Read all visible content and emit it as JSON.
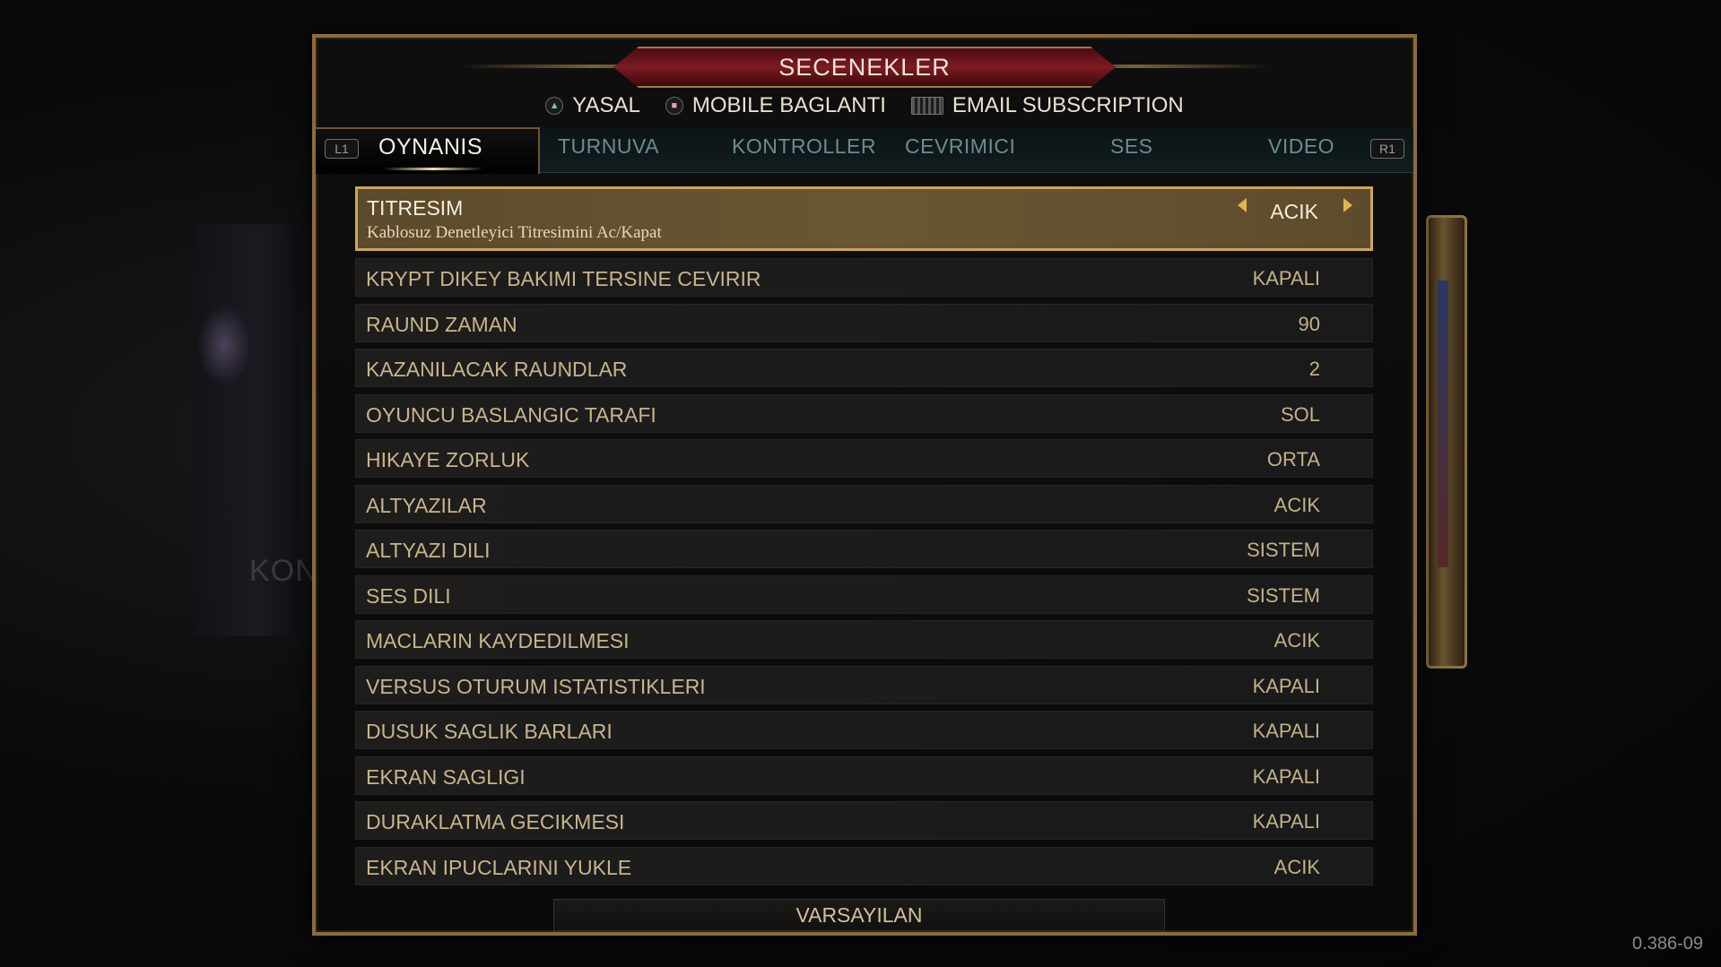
{
  "window": {
    "title": "SECENEKLER"
  },
  "subnav": [
    {
      "label": "YASAL",
      "icon": "triangle-button-icon"
    },
    {
      "label": "MOBILE BAGLANTI",
      "icon": "square-button-icon"
    },
    {
      "label": "EMAIL SUBSCRIPTION",
      "icon": "keyboard-icon"
    }
  ],
  "tabs": {
    "left_shoulder": "L1",
    "right_shoulder": "R1",
    "items": [
      "OYNANIS",
      "TURNUVA",
      "KONTROLLER",
      "CEVRIMICI",
      "SES",
      "VIDEO"
    ],
    "active": "OYNANIS"
  },
  "selected_option": {
    "label": "TITRESIM",
    "description": "Kablosuz Denetleyici Titresimini Ac/Kapat",
    "value": "ACIK"
  },
  "options": [
    {
      "label": "KRYPT DIKEY BAKIMI TERSINE CEVIRIR",
      "value": "KAPALI"
    },
    {
      "label": "RAUND ZAMAN",
      "value": "90"
    },
    {
      "label": "KAZANILACAK RAUNDLAR",
      "value": "2"
    },
    {
      "label": "OYUNCU BASLANGIC TARAFI",
      "value": "SOL"
    },
    {
      "label": "HIKAYE ZORLUK",
      "value": "ORTA"
    },
    {
      "label": "ALTYAZILAR",
      "value": "ACIK"
    },
    {
      "label": "ALTYAZI DILI",
      "value": "SISTEM"
    },
    {
      "label": "SES DILI",
      "value": "SISTEM"
    },
    {
      "label": "MACLARIN KAYDEDILMESI",
      "value": "ACIK"
    },
    {
      "label": "VERSUS OTURUM ISTATISTIKLERI",
      "value": "KAPALI"
    },
    {
      "label": "DUSUK SAGLIK BARLARI",
      "value": "KAPALI"
    },
    {
      "label": "EKRAN SAGLIGI",
      "value": "KAPALI"
    },
    {
      "label": "DURAKLATMA GECIKMESI",
      "value": "KAPALI"
    },
    {
      "label": "EKRAN IPUCLARINI YUKLE",
      "value": "ACIK"
    }
  ],
  "footer": {
    "default_button": "VARSAYILAN"
  },
  "background": {
    "partial_text": "KON"
  },
  "version": "0.386-09",
  "colors": {
    "frame_gold": "#8a6c3b",
    "title_red": "#7d1a22",
    "highlight": "#6a5632"
  }
}
